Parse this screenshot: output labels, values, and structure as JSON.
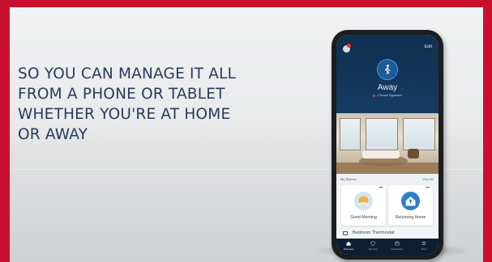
{
  "headline": {
    "line1": "SO YOU CAN MANAGE IT ALL",
    "line2": "FROM A PHONE OR TABLET",
    "line3": "WHETHER YOU'RE AT HOME",
    "line4": "OR AWAY"
  },
  "app": {
    "edit_label": "Edit",
    "status_label": "Away",
    "status_sub": "1 Sensor Bypassed",
    "scenes_title": "My Scenes",
    "view_all_label": "View All",
    "scenes": [
      {
        "label": "Good Morning",
        "icon": "sun-icon",
        "color": "#f2b33d"
      },
      {
        "label": "Returning Home",
        "icon": "home-icon",
        "color": "#2e7fc6"
      }
    ],
    "device_label": "Bedroom Thermostat",
    "tabs": [
      {
        "label": "Overview",
        "icon": "home-icon"
      },
      {
        "label": "Security",
        "icon": "shield-icon"
      },
      {
        "label": "Automation",
        "icon": "automation-icon"
      },
      {
        "label": "More",
        "icon": "menu-icon"
      }
    ]
  },
  "colors": {
    "border": "#c8102e",
    "headline": "#2a3a5c",
    "app_header": "#0f2f4f",
    "accent": "#1c7fd6"
  }
}
